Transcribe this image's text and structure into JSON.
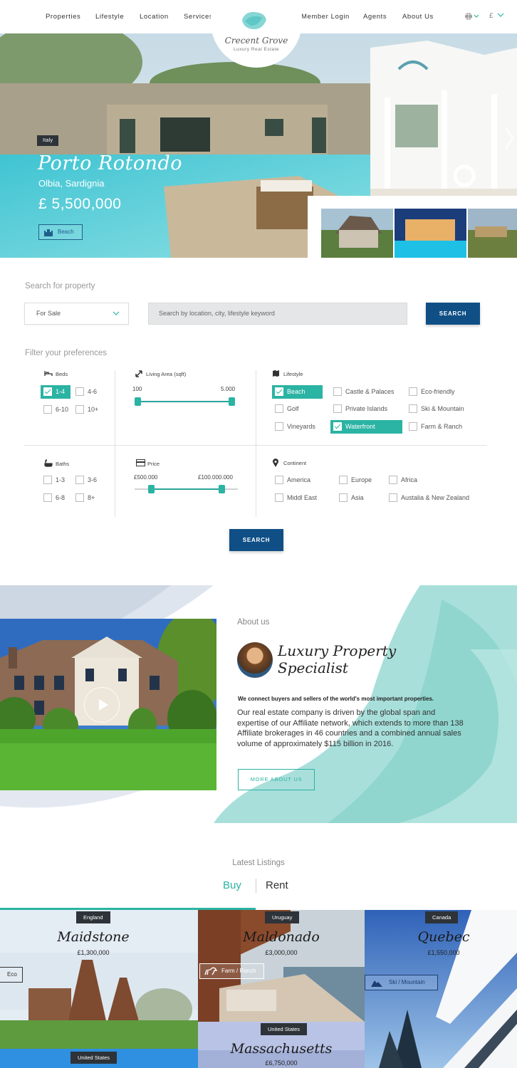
{
  "nav": {
    "left": [
      "Properties",
      "Lifestyle",
      "Location",
      "Services"
    ],
    "right": [
      "Member Login",
      "Agents",
      "About Us"
    ],
    "currency": "£"
  },
  "logo": {
    "title": "Crecent Grove",
    "subtitle": "Luxury Real Estate"
  },
  "hero": {
    "tag": "Italy",
    "name": "Porto Rotondo",
    "location": "Olbia, Sardignia",
    "price": "£ 5,500,000",
    "badge": "Beach"
  },
  "search": {
    "heading": "Search for property",
    "type": "For Sale",
    "placeholder": "Search by location, city, lifestyle keyword",
    "button": "SEARCH"
  },
  "filters": {
    "heading": "Filter your preferences",
    "beds": {
      "label": "Beds",
      "options": [
        "1-4",
        "4-6",
        "6-10",
        "10+"
      ],
      "selected": "1-4"
    },
    "living_area": {
      "label": "Living Area (sqft)",
      "min": "100",
      "max": "5.000",
      "range_fraction": [
        0.0,
        1.0
      ]
    },
    "lifestyle": {
      "label": "Lifestyle",
      "options": [
        "Beach",
        "Castle & Palaces",
        "Eco-friendly",
        "Golf",
        "Private Islands",
        "Ski & Mountain",
        "Vineyards",
        "Waterfront",
        "Farm & Ranch"
      ],
      "selected": [
        "Beach",
        "Waterfront"
      ]
    },
    "baths": {
      "label": "Baths",
      "options": [
        "1-3",
        "3-6",
        "6-8",
        "8+"
      ]
    },
    "price": {
      "label": "Price",
      "min": "£500.000",
      "max": "£100.000.000",
      "range_fraction": [
        0.16,
        0.84
      ]
    },
    "continent": {
      "label": "Continent",
      "options": [
        "America",
        "Europe",
        "Africa",
        "Middl East",
        "Asia",
        "Austalia & New Zealand"
      ]
    },
    "button": "SEARCH"
  },
  "about": {
    "label": "About us",
    "title_line1": "Luxury Property",
    "title_line2": "Specialist",
    "lead": "We connect buyers and sellers of the world's most important properties.",
    "body": "Our real estate company is driven by the global span and expertise of our Affiliate network, which extends to more than 138 Affiliate brokerages in 46 countries and a combined annual sales volume of approximately $115 billion in 2016.",
    "button": "MORE ABOUT US"
  },
  "listings": {
    "heading": "Latest Listings",
    "tabs": [
      "Buy",
      "Rent"
    ],
    "active_tab": "Buy",
    "cards": [
      {
        "tag": "England",
        "name": "Maidstone",
        "price": "£1,300,000",
        "badge": "Eco"
      },
      {
        "tag": "Uruguay",
        "name": "Maldonado",
        "price": "£3,000,000",
        "badge": "Farm / Ranch"
      },
      {
        "tag": "Canada",
        "name": "Quebec",
        "price": "£1,550,000",
        "badge": "Ski / Mountain"
      },
      {
        "tag": "United States",
        "name": "Massachusetts",
        "price": "£6,750,000"
      },
      {
        "tag": "United States"
      }
    ]
  },
  "colors": {
    "accent": "#2bb3a3",
    "primary": "#0f4f86",
    "dark_tag": "#2d3338"
  }
}
